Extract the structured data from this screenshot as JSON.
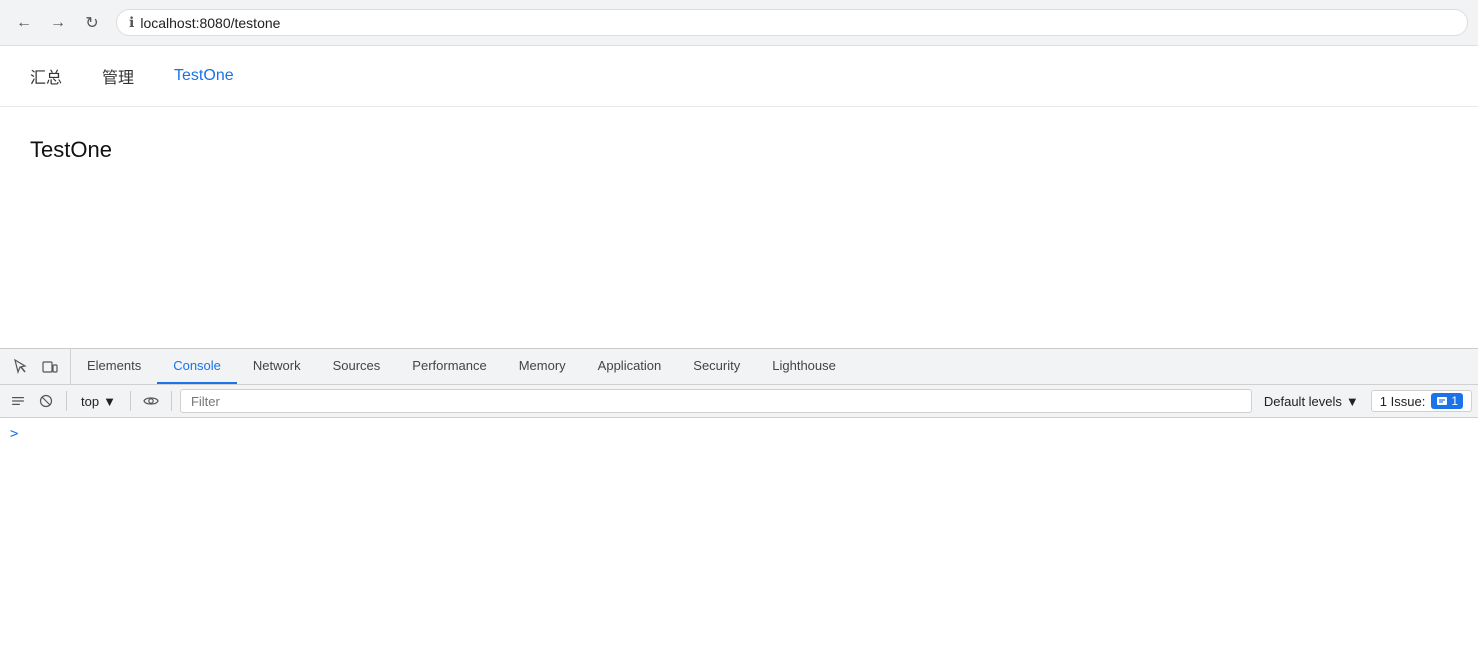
{
  "browser": {
    "back_label": "←",
    "forward_label": "→",
    "reload_label": "↻",
    "url": "localhost:8080/testone",
    "info_icon": "ℹ"
  },
  "site": {
    "nav": [
      {
        "label": "汇总",
        "active": false
      },
      {
        "label": "管理",
        "active": false
      },
      {
        "label": "TestOne",
        "active": true
      }
    ],
    "page_title": "TestOne"
  },
  "devtools": {
    "tabs": [
      {
        "label": "Elements",
        "active": false
      },
      {
        "label": "Console",
        "active": true
      },
      {
        "label": "Network",
        "active": false
      },
      {
        "label": "Sources",
        "active": false
      },
      {
        "label": "Performance",
        "active": false
      },
      {
        "label": "Memory",
        "active": false
      },
      {
        "label": "Application",
        "active": false
      },
      {
        "label": "Security",
        "active": false
      },
      {
        "label": "Lighthouse",
        "active": false
      }
    ],
    "console": {
      "top_label": "top",
      "filter_placeholder": "Filter",
      "default_levels_label": "Default levels",
      "issue_label": "1 Issue:",
      "issue_count": "1",
      "prompt_symbol": ">"
    }
  }
}
